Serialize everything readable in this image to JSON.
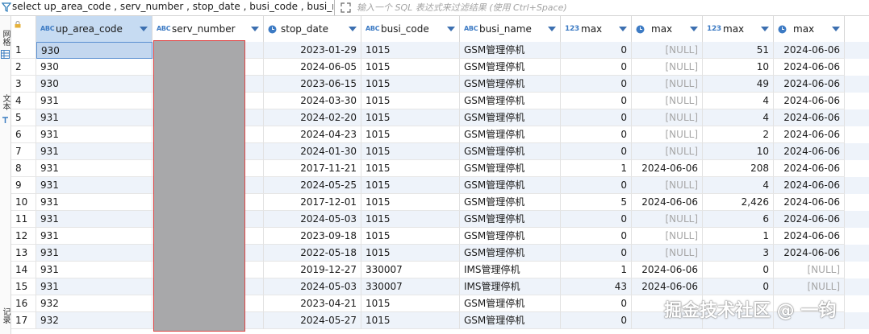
{
  "filter_bar": {
    "sql_text": "select up_area_code , serv_number , stop_date , busi_code , busi_nar",
    "placeholder": "输入一个 SQL 表达式来过滤结果 (使用 Ctrl+Space)"
  },
  "side_panel": {
    "tabs": [
      "网格",
      "文本",
      "记录"
    ]
  },
  "columns": [
    {
      "label": "up_area_code",
      "type": "abc"
    },
    {
      "label": "serv_number",
      "type": "abc"
    },
    {
      "label": "stop_date",
      "type": "date"
    },
    {
      "label": "busi_code",
      "type": "abc"
    },
    {
      "label": "busi_name",
      "type": "abc"
    },
    {
      "label": "max",
      "type": "123"
    },
    {
      "label": "max",
      "type": "date"
    },
    {
      "label": "max",
      "type": "123"
    },
    {
      "label": "max",
      "type": "date"
    }
  ],
  "type_badges": {
    "abc": "ABC",
    "num": "123"
  },
  "rows": [
    {
      "n": "1",
      "area": "930",
      "date": "2023-01-29",
      "code": "1015",
      "name": "GSM管理停机",
      "m1": "0",
      "m2": "[NULL]",
      "m3": "51",
      "m4": "2024-06-06"
    },
    {
      "n": "2",
      "area": "930",
      "date": "2024-06-05",
      "code": "1015",
      "name": "GSM管理停机",
      "m1": "0",
      "m2": "[NULL]",
      "m3": "10",
      "m4": "2024-06-06"
    },
    {
      "n": "3",
      "area": "930",
      "date": "2023-06-15",
      "code": "1015",
      "name": "GSM管理停机",
      "m1": "0",
      "m2": "[NULL]",
      "m3": "49",
      "m4": "2024-06-06"
    },
    {
      "n": "4",
      "area": "931",
      "date": "2024-03-30",
      "code": "1015",
      "name": "GSM管理停机",
      "m1": "0",
      "m2": "[NULL]",
      "m3": "4",
      "m4": "2024-06-06"
    },
    {
      "n": "5",
      "area": "931",
      "date": "2024-02-20",
      "code": "1015",
      "name": "GSM管理停机",
      "m1": "0",
      "m2": "[NULL]",
      "m3": "4",
      "m4": "2024-06-06"
    },
    {
      "n": "6",
      "area": "931",
      "date": "2024-04-23",
      "code": "1015",
      "name": "GSM管理停机",
      "m1": "0",
      "m2": "[NULL]",
      "m3": "2",
      "m4": "2024-06-06"
    },
    {
      "n": "7",
      "area": "931",
      "date": "2024-01-30",
      "code": "1015",
      "name": "GSM管理停机",
      "m1": "0",
      "m2": "[NULL]",
      "m3": "10",
      "m4": "2024-06-06"
    },
    {
      "n": "8",
      "area": "931",
      "date": "2017-11-21",
      "code": "1015",
      "name": "GSM管理停机",
      "m1": "1",
      "m2": "2024-06-06",
      "m3": "208",
      "m4": "2024-06-06"
    },
    {
      "n": "9",
      "area": "931",
      "date": "2024-05-25",
      "code": "1015",
      "name": "GSM管理停机",
      "m1": "0",
      "m2": "[NULL]",
      "m3": "4",
      "m4": "2024-06-06"
    },
    {
      "n": "10",
      "area": "931",
      "date": "2017-12-01",
      "code": "1015",
      "name": "GSM管理停机",
      "m1": "5",
      "m2": "2024-06-06",
      "m3": "2,426",
      "m4": "2024-06-06"
    },
    {
      "n": "11",
      "area": "931",
      "date": "2024-05-03",
      "code": "1015",
      "name": "GSM管理停机",
      "m1": "0",
      "m2": "[NULL]",
      "m3": "6",
      "m4": "2024-06-06"
    },
    {
      "n": "12",
      "area": "931",
      "date": "2023-09-18",
      "code": "1015",
      "name": "GSM管理停机",
      "m1": "0",
      "m2": "[NULL]",
      "m3": "1",
      "m4": "2024-06-06"
    },
    {
      "n": "13",
      "area": "931",
      "date": "2022-05-18",
      "code": "1015",
      "name": "GSM管理停机",
      "m1": "0",
      "m2": "[NULL]",
      "m3": "3",
      "m4": "2024-06-06"
    },
    {
      "n": "14",
      "area": "931",
      "date": "2019-12-27",
      "code": "330007",
      "name": "IMS管理停机",
      "m1": "1",
      "m2": "2024-06-06",
      "m3": "0",
      "m4": "[NULL]"
    },
    {
      "n": "15",
      "area": "931",
      "date": "2024-05-03",
      "code": "330007",
      "name": "IMS管理停机",
      "m1": "43",
      "m2": "2024-06-06",
      "m3": "0",
      "m4": "[NULL]"
    },
    {
      "n": "16",
      "area": "932",
      "date": "2023-04-21",
      "code": "1015",
      "name": "GSM管理停机",
      "m1": "0",
      "m2": "",
      "m3": "",
      "m4": ""
    },
    {
      "n": "17",
      "area": "932",
      "date": "2024-05-27",
      "code": "1015",
      "name": "GSM管理停机",
      "m1": "0",
      "m2": "",
      "m3": "",
      "m4": ""
    }
  ],
  "watermark": "掘金技术社区 @ 一钧"
}
